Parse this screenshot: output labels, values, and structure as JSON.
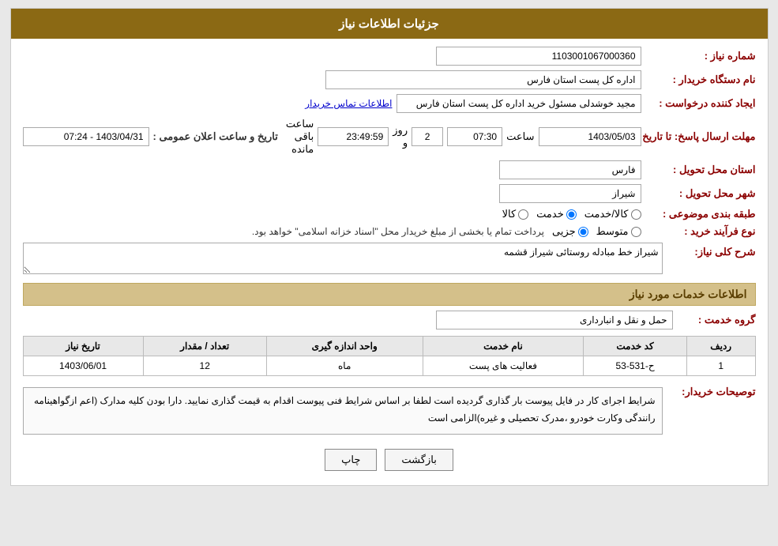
{
  "header": {
    "title": "جزئیات اطلاعات نیاز"
  },
  "fields": {
    "order_number_label": "شماره نیاز :",
    "order_number_value": "1103001067000360",
    "buyer_label": "نام دستگاه خریدار :",
    "buyer_value": "اداره کل پست استان فارس",
    "creator_label": "ایجاد کننده درخواست :",
    "creator_name": "مجید خوشدلی مسئول خرید اداره کل پست استان فارس",
    "creator_link": "اطلاعات تماس خریدار",
    "date_label": "مهلت ارسال پاسخ: تا تاریخ:",
    "date_from": "1403/05/03",
    "time_label": "ساعت",
    "time_value": "07:30",
    "days_label": "روز و",
    "days_value": "2",
    "remaining_label": "ساعت باقی مانده",
    "remaining_value": "23:49:59",
    "public_date_label": "تاریخ و ساعت اعلان عمومی :",
    "public_date_value": "1403/04/31 - 07:24",
    "province_label": "استان محل تحویل :",
    "province_value": "فارس",
    "city_label": "شهر محل تحویل :",
    "city_value": "شیراز",
    "category_label": "طبقه بندی موضوعی :",
    "category_options": [
      "کالا",
      "خدمت",
      "کالا/خدمت"
    ],
    "category_selected": "خدمت",
    "purchase_type_label": "نوع فرآیند خرید :",
    "purchase_types": [
      "جزیی",
      "متوسط"
    ],
    "purchase_description": "پرداخت تمام یا بخشی از مبلغ خریدار محل \"اسناد خزانه اسلامی\" خواهد بود.",
    "needs_label": "شرح کلی نیاز:",
    "needs_value": "شیراز خط مبادله روستائی شیراز قشمه"
  },
  "services_section": {
    "title": "اطلاعات خدمات مورد نیاز",
    "service_group_label": "گروه خدمت :",
    "service_group_value": "حمل و نقل و انبارداری",
    "table": {
      "columns": [
        "ردیف",
        "کد خدمت",
        "نام خدمت",
        "واحد اندازه گیری",
        "تعداد / مقدار",
        "تاریخ نیاز"
      ],
      "rows": [
        {
          "row": "1",
          "code": "ح-531-53",
          "name": "فعالیت های پست",
          "unit": "ماه",
          "count": "12",
          "date": "1403/06/01"
        }
      ]
    }
  },
  "notes_section": {
    "label": "توصیحات خریدار:",
    "text": "شرایط اجرای کار در فایل پیوست بار گذاری گردیده است لطفا بر اساس شرایط فنی پیوست اقدام به قیمت گذاری نمایید. دارا بودن کلیه مدارک (اعم ازگواهینامه رانندگی وکارت خودرو ،مدرک تحصیلی و غیره)الزامی است"
  },
  "buttons": {
    "print": "چاپ",
    "back": "بازگشت"
  }
}
